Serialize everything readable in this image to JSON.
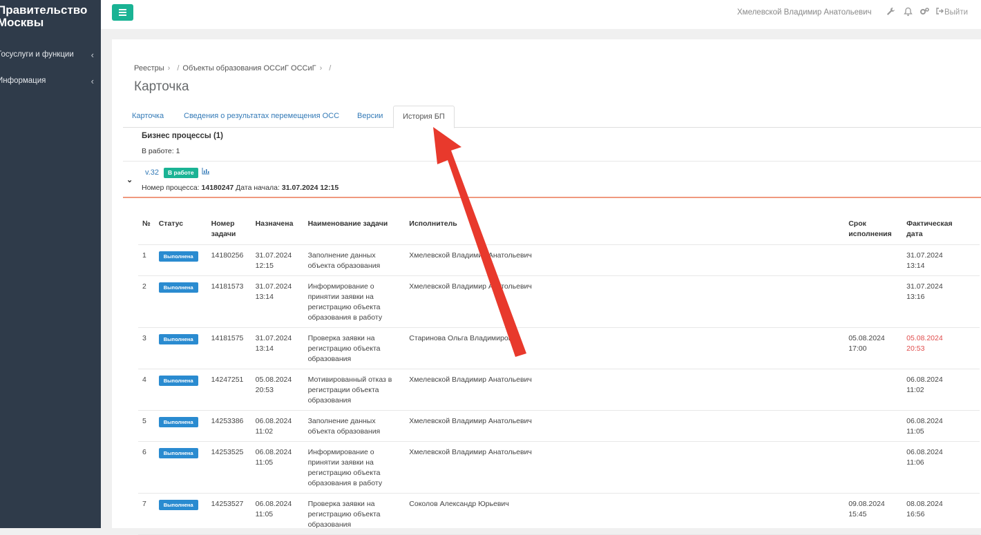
{
  "sidebar": {
    "brand_line1": "Правительство",
    "brand_line2": "Москвы",
    "items": [
      {
        "label": "Госуслуги и функции"
      },
      {
        "label": "Информация"
      }
    ]
  },
  "topbar": {
    "user_name": "Хмелевской Владимир Анатольевич",
    "logout_label": "Выйти"
  },
  "breadcrumb": {
    "items": [
      "Реестры",
      "Объекты образования ОССиГ ОССиГ"
    ]
  },
  "page_title": "Карточка",
  "tabs": [
    {
      "label": "Карточка"
    },
    {
      "label": "Сведения о результатах перемещения ОСС"
    },
    {
      "label": "Версии"
    },
    {
      "label": "История БП",
      "active": true
    }
  ],
  "bp": {
    "title": "Бизнес процессы (1)",
    "in_work": "В работе: 1",
    "version": "v.32",
    "version_badge": "В работе",
    "process_label": "Номер процесса:",
    "process_number": "14180247",
    "start_label": "Дата начала:",
    "start_date": "31.07.2024 12:15"
  },
  "table": {
    "headers": {
      "num": "№",
      "status": "Статус",
      "task_number_1": "Номер",
      "task_number_2": "задачи",
      "assigned": "Назначена",
      "task_name": "Наименование задачи",
      "executor": "Исполнитель",
      "deadline_1": "Срок",
      "deadline_2": "исполнения",
      "actual_1": "Фактическая",
      "actual_2": "дата"
    },
    "rows": [
      {
        "num": "1",
        "status": "Выполнена",
        "task_number": "14180256",
        "assigned_date": "31.07.2024",
        "assigned_time": "12:15",
        "task_name": "Заполнение данных объекта образования",
        "executor": "Хмелевской Владимир Анатольевич",
        "deadline_date": "",
        "deadline_time": "",
        "actual_date": "31.07.2024",
        "actual_time": "13:14",
        "late": false
      },
      {
        "num": "2",
        "status": "Выполнена",
        "task_number": "14181573",
        "assigned_date": "31.07.2024",
        "assigned_time": "13:14",
        "task_name": "Информирование о принятии заявки на регистрацию объекта образования в работу",
        "executor": "Хмелевской Владимир Анатольевич",
        "deadline_date": "",
        "deadline_time": "",
        "actual_date": "31.07.2024",
        "actual_time": "13:16",
        "late": false
      },
      {
        "num": "3",
        "status": "Выполнена",
        "task_number": "14181575",
        "assigned_date": "31.07.2024",
        "assigned_time": "13:14",
        "task_name": "Проверка заявки на регистрацию объекта образования",
        "executor": "Старинова Ольга Владимировна",
        "deadline_date": "05.08.2024",
        "deadline_time": "17:00",
        "actual_date": "05.08.2024",
        "actual_time": "20:53",
        "late": true
      },
      {
        "num": "4",
        "status": "Выполнена",
        "task_number": "14247251",
        "assigned_date": "05.08.2024",
        "assigned_time": "20:53",
        "task_name": "Мотивированный отказ в регистрации объекта образования",
        "executor": "Хмелевской Владимир Анатольевич",
        "deadline_date": "",
        "deadline_time": "",
        "actual_date": "06.08.2024",
        "actual_time": "11:02",
        "late": false
      },
      {
        "num": "5",
        "status": "Выполнена",
        "task_number": "14253386",
        "assigned_date": "06.08.2024",
        "assigned_time": "11:02",
        "task_name": "Заполнение данных объекта образования",
        "executor": "Хмелевской Владимир Анатольевич",
        "deadline_date": "",
        "deadline_time": "",
        "actual_date": "06.08.2024",
        "actual_time": "11:05",
        "late": false
      },
      {
        "num": "6",
        "status": "Выполнена",
        "task_number": "14253525",
        "assigned_date": "06.08.2024",
        "assigned_time": "11:05",
        "task_name": "Информирование о принятии заявки на регистрацию объекта образования в работу",
        "executor": "Хмелевской Владимир Анатольевич",
        "deadline_date": "",
        "deadline_time": "",
        "actual_date": "06.08.2024",
        "actual_time": "11:06",
        "late": false
      },
      {
        "num": "7",
        "status": "Выполнена",
        "task_number": "14253527",
        "assigned_date": "06.08.2024",
        "assigned_time": "11:05",
        "task_name": "Проверка заявки на регистрацию объекта образования",
        "executor": "Соколов Александр Юрьевич",
        "deadline_date": "09.08.2024",
        "deadline_time": "15:45",
        "actual_date": "08.08.2024",
        "actual_time": "16:56",
        "late": false
      }
    ]
  },
  "colors": {
    "sidebar_bg": "#2f3b4a",
    "accent_green": "#1ab394",
    "status_blue": "#2a8bd0",
    "late_red": "#e04b4b",
    "annotation_arrow": "#e8392c"
  }
}
